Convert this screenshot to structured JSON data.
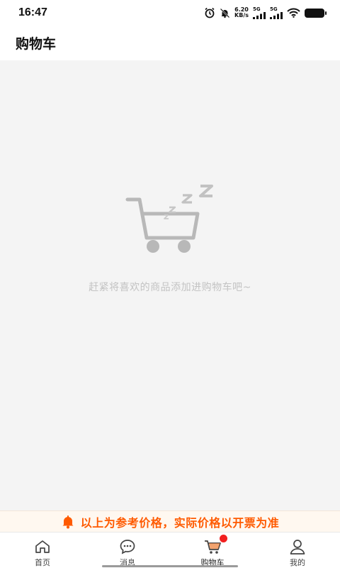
{
  "status_bar": {
    "time": "16:47",
    "net_speed_value": "6.20",
    "net_speed_unit": "KB/s",
    "signal1_tag": "5G",
    "signal2_tag": "5G",
    "icons": [
      "alarm-icon",
      "mute-icon",
      "signal-icon",
      "signal-icon",
      "wifi-icon",
      "battery-icon"
    ]
  },
  "header": {
    "title": "购物车"
  },
  "empty_state": {
    "icon": "empty-cart-sleeping-icon",
    "message": "赶紧将喜欢的商品添加进购物车吧~"
  },
  "notice": {
    "icon": "bell-icon",
    "text": "以上为参考价格，实际价格以开票为准",
    "color": "#ff5a00"
  },
  "tabbar": {
    "tabs": [
      {
        "label": "首页",
        "icon": "home-icon"
      },
      {
        "label": "消息",
        "icon": "message-icon"
      },
      {
        "label": "购物车",
        "icon": "cart-icon",
        "active": true,
        "badge": "dot"
      },
      {
        "label": "我的",
        "icon": "user-icon"
      }
    ]
  }
}
